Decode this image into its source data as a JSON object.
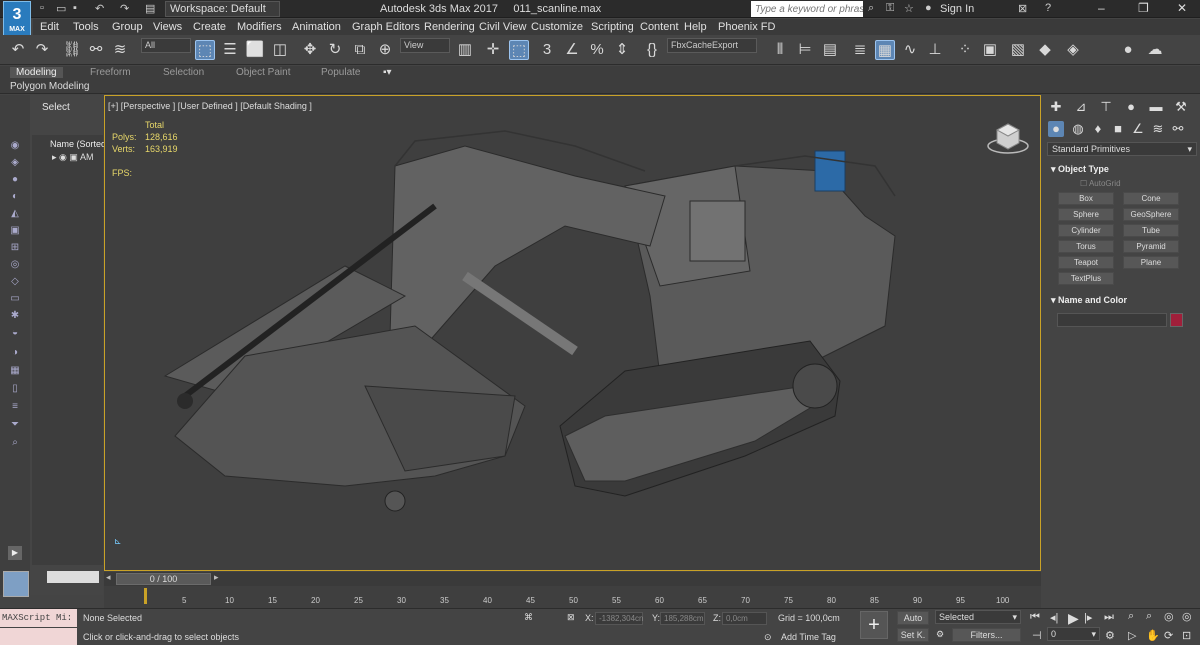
{
  "app": {
    "logo_text": "3",
    "logo_sub": "MAX",
    "workspace": "Workspace: Default",
    "app_name": "Autodesk 3ds Max 2017",
    "file_name": "011_scanline.max",
    "search_placeholder": "Type a keyword or phrase",
    "sign_in": "Sign In"
  },
  "menu": [
    "Edit",
    "Tools",
    "Group",
    "Views",
    "Create",
    "Modifiers",
    "Animation",
    "Graph Editors",
    "Rendering",
    "Civil View",
    "Customize",
    "Scripting",
    "Content",
    "Help",
    "Phoenix FD"
  ],
  "toolbar": {
    "filter": "All",
    "ref_coord": "View",
    "named_sel": "FbxCacheExport"
  },
  "ribbon": {
    "tabs": [
      "Modeling",
      "Freeform",
      "Selection",
      "Object Paint",
      "Populate"
    ],
    "active_tab": "Modeling",
    "sub_label": "Polygon Modeling"
  },
  "scene_explorer": {
    "select_label": "Select",
    "header": "Name (Sorted",
    "row": "AM"
  },
  "viewport": {
    "label": "[+] [Perspective ] [User Defined ] [Default Shading ]",
    "stats_total": "Total",
    "polys_label": "Polys:",
    "polys_value": "128,616",
    "verts_label": "Verts:",
    "verts_value": "163,919",
    "fps_label": "FPS:"
  },
  "command_panel": {
    "category": "Standard Primitives",
    "object_type_title": "Object Type",
    "autogrid": "AutoGrid",
    "buttons": [
      "Box",
      "Cone",
      "Sphere",
      "GeoSphere",
      "Cylinder",
      "Tube",
      "Torus",
      "Pyramid",
      "Teapot",
      "Plane",
      "TextPlus"
    ],
    "name_color_title": "Name and Color",
    "object_color": "#a01f3a"
  },
  "timeline": {
    "frame": "0 / 100",
    "ticks": [
      "5",
      "10",
      "15",
      "20",
      "25",
      "30",
      "35",
      "40",
      "45",
      "50",
      "55",
      "60",
      "65",
      "70",
      "75",
      "80",
      "85",
      "90",
      "95",
      "100"
    ]
  },
  "status": {
    "maxscript": "MAXScript Mi:",
    "selection": "None Selected",
    "prompt": "Click or click-and-drag to select objects",
    "x_label": "X:",
    "x_value": "-1382,304cn",
    "y_label": "Y:",
    "y_value": "185,288cm",
    "z_label": "Z:",
    "z_value": "0,0cm",
    "grid": "Grid = 100,0cm",
    "add_time_tag": "Add Time Tag",
    "auto": "Auto",
    "set_key": "Set K.",
    "key_mode": "Selected",
    "filters": "Filters...",
    "frame_field": "0"
  }
}
